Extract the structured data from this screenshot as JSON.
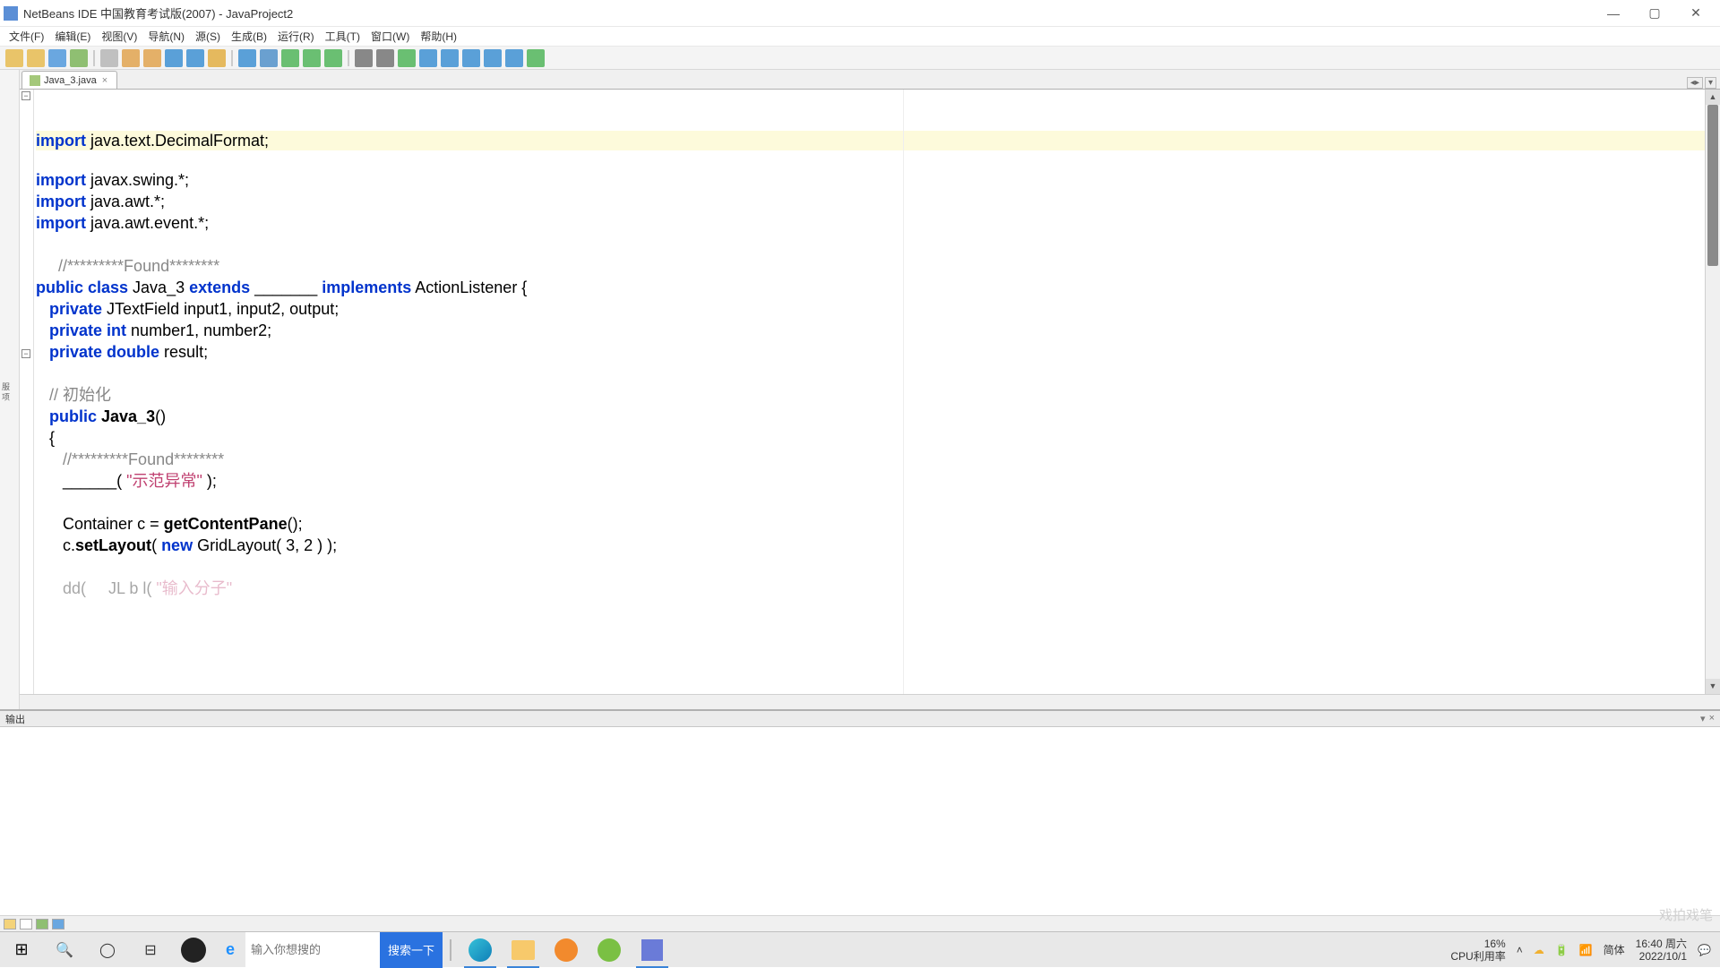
{
  "titlebar": {
    "title": "NetBeans IDE 中国教育考试版(2007) - JavaProject2"
  },
  "menu": [
    "文件(F)",
    "编辑(E)",
    "视图(V)",
    "导航(N)",
    "源(S)",
    "生成(B)",
    "运行(R)",
    "工具(T)",
    "窗口(W)",
    "帮助(H)"
  ],
  "toolbar_colors": [
    "#e9c469",
    "#e9c469",
    "#6aa7e0",
    "#8fbf72",
    "#c0c0c0",
    "#e4b068",
    "#e4b068",
    "#5aa0d8",
    "#5aa0d8",
    "#e5b95e",
    "#5aa0d8",
    "#6aa0d0",
    "#6abf72",
    "#6abf72",
    "#6abf72",
    "#6abf72",
    "#888",
    "#888",
    "#6abf72",
    "#5aa0d8",
    "#5aa0d8",
    "#5aa0d8",
    "#5aa0d8",
    "#5aa0d8",
    "#6abf72"
  ],
  "tab": {
    "label": "Java_3.java"
  },
  "code": {
    "l1_kw": "import",
    "l1_rest": " java.text.DecimalFormat;",
    "l2_kw": "import",
    "l2_rest": " javax.swing.*;",
    "l3_kw": "import",
    "l3_rest": " java.awt.*;",
    "l4_kw": "import",
    "l4_rest": " java.awt.event.*;",
    "l6_cm": "//*********Found********",
    "l7_p1": "public class",
    "l7_name": " Java_3 ",
    "l7_ext": "extends",
    "l7_blank": " _______ ",
    "l7_imp": "implements",
    "l7_rest": " ActionListener {",
    "l8_kw": "private",
    "l8_rest": " JTextField input1, input2, output;",
    "l9_kw": "private int",
    "l9_rest": " number1, number2;",
    "l10_kw": "private double",
    "l10_rest": " result;",
    "l12_cm": "// 初始化",
    "l13_kw": "public",
    "l13_name": " Java_3",
    "l13_rest": "()",
    "l14": "{",
    "l15_cm": "//*********Found********",
    "l16_blank": "______( ",
    "l16_str": "\"示范异常\"",
    "l16_end": " );",
    "l18_a": "Container c = ",
    "l18_fn": "getContentPane",
    "l18_b": "();",
    "l19_a": "c.",
    "l19_fn": "setLayout",
    "l19_b": "( ",
    "l19_kw": "new",
    "l19_c": " GridLayout( 3, 2 ) );",
    "l21_pre": "      dd(     JL b l( ",
    "l21_str": "\"输入分子\"",
    "l21_end": ""
  },
  "output_panel": {
    "title": "输出"
  },
  "taskbar": {
    "search_placeholder": "输入你想搜的",
    "search_button": "搜索一下",
    "cpu_pct": "16%",
    "cpu_label": "CPU利用率",
    "ime": "简体",
    "time": "16:40",
    "day": "周六",
    "date": "2022/10/1"
  },
  "watermark": "戏拍戏笔"
}
